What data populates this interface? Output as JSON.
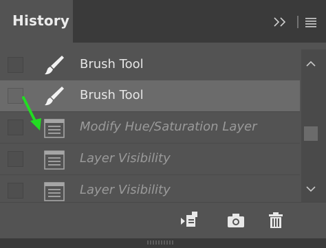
{
  "panel": {
    "tab_title": "History",
    "icons": {
      "collapse": "double-chevron-right-icon",
      "menu": "hamburger-menu-icon"
    }
  },
  "history": {
    "items": [
      {
        "label": "Brush Tool",
        "icon": "brush-icon",
        "state": "normal"
      },
      {
        "label": "Brush Tool",
        "icon": "brush-icon",
        "state": "selected"
      },
      {
        "label": "Modify Hue/Saturation Layer",
        "icon": "document-icon",
        "state": "future"
      },
      {
        "label": "Layer Visibility",
        "icon": "document-icon",
        "state": "future"
      },
      {
        "label": "Layer Visibility",
        "icon": "document-icon",
        "state": "future"
      }
    ]
  },
  "footer": {
    "icons": [
      "new-document-from-state-icon",
      "camera-icon",
      "trash-icon"
    ]
  },
  "colors": {
    "panel_bg": "#535353",
    "selected_row": "#6b6b6b",
    "annotation_arrow": "#22dd22"
  }
}
